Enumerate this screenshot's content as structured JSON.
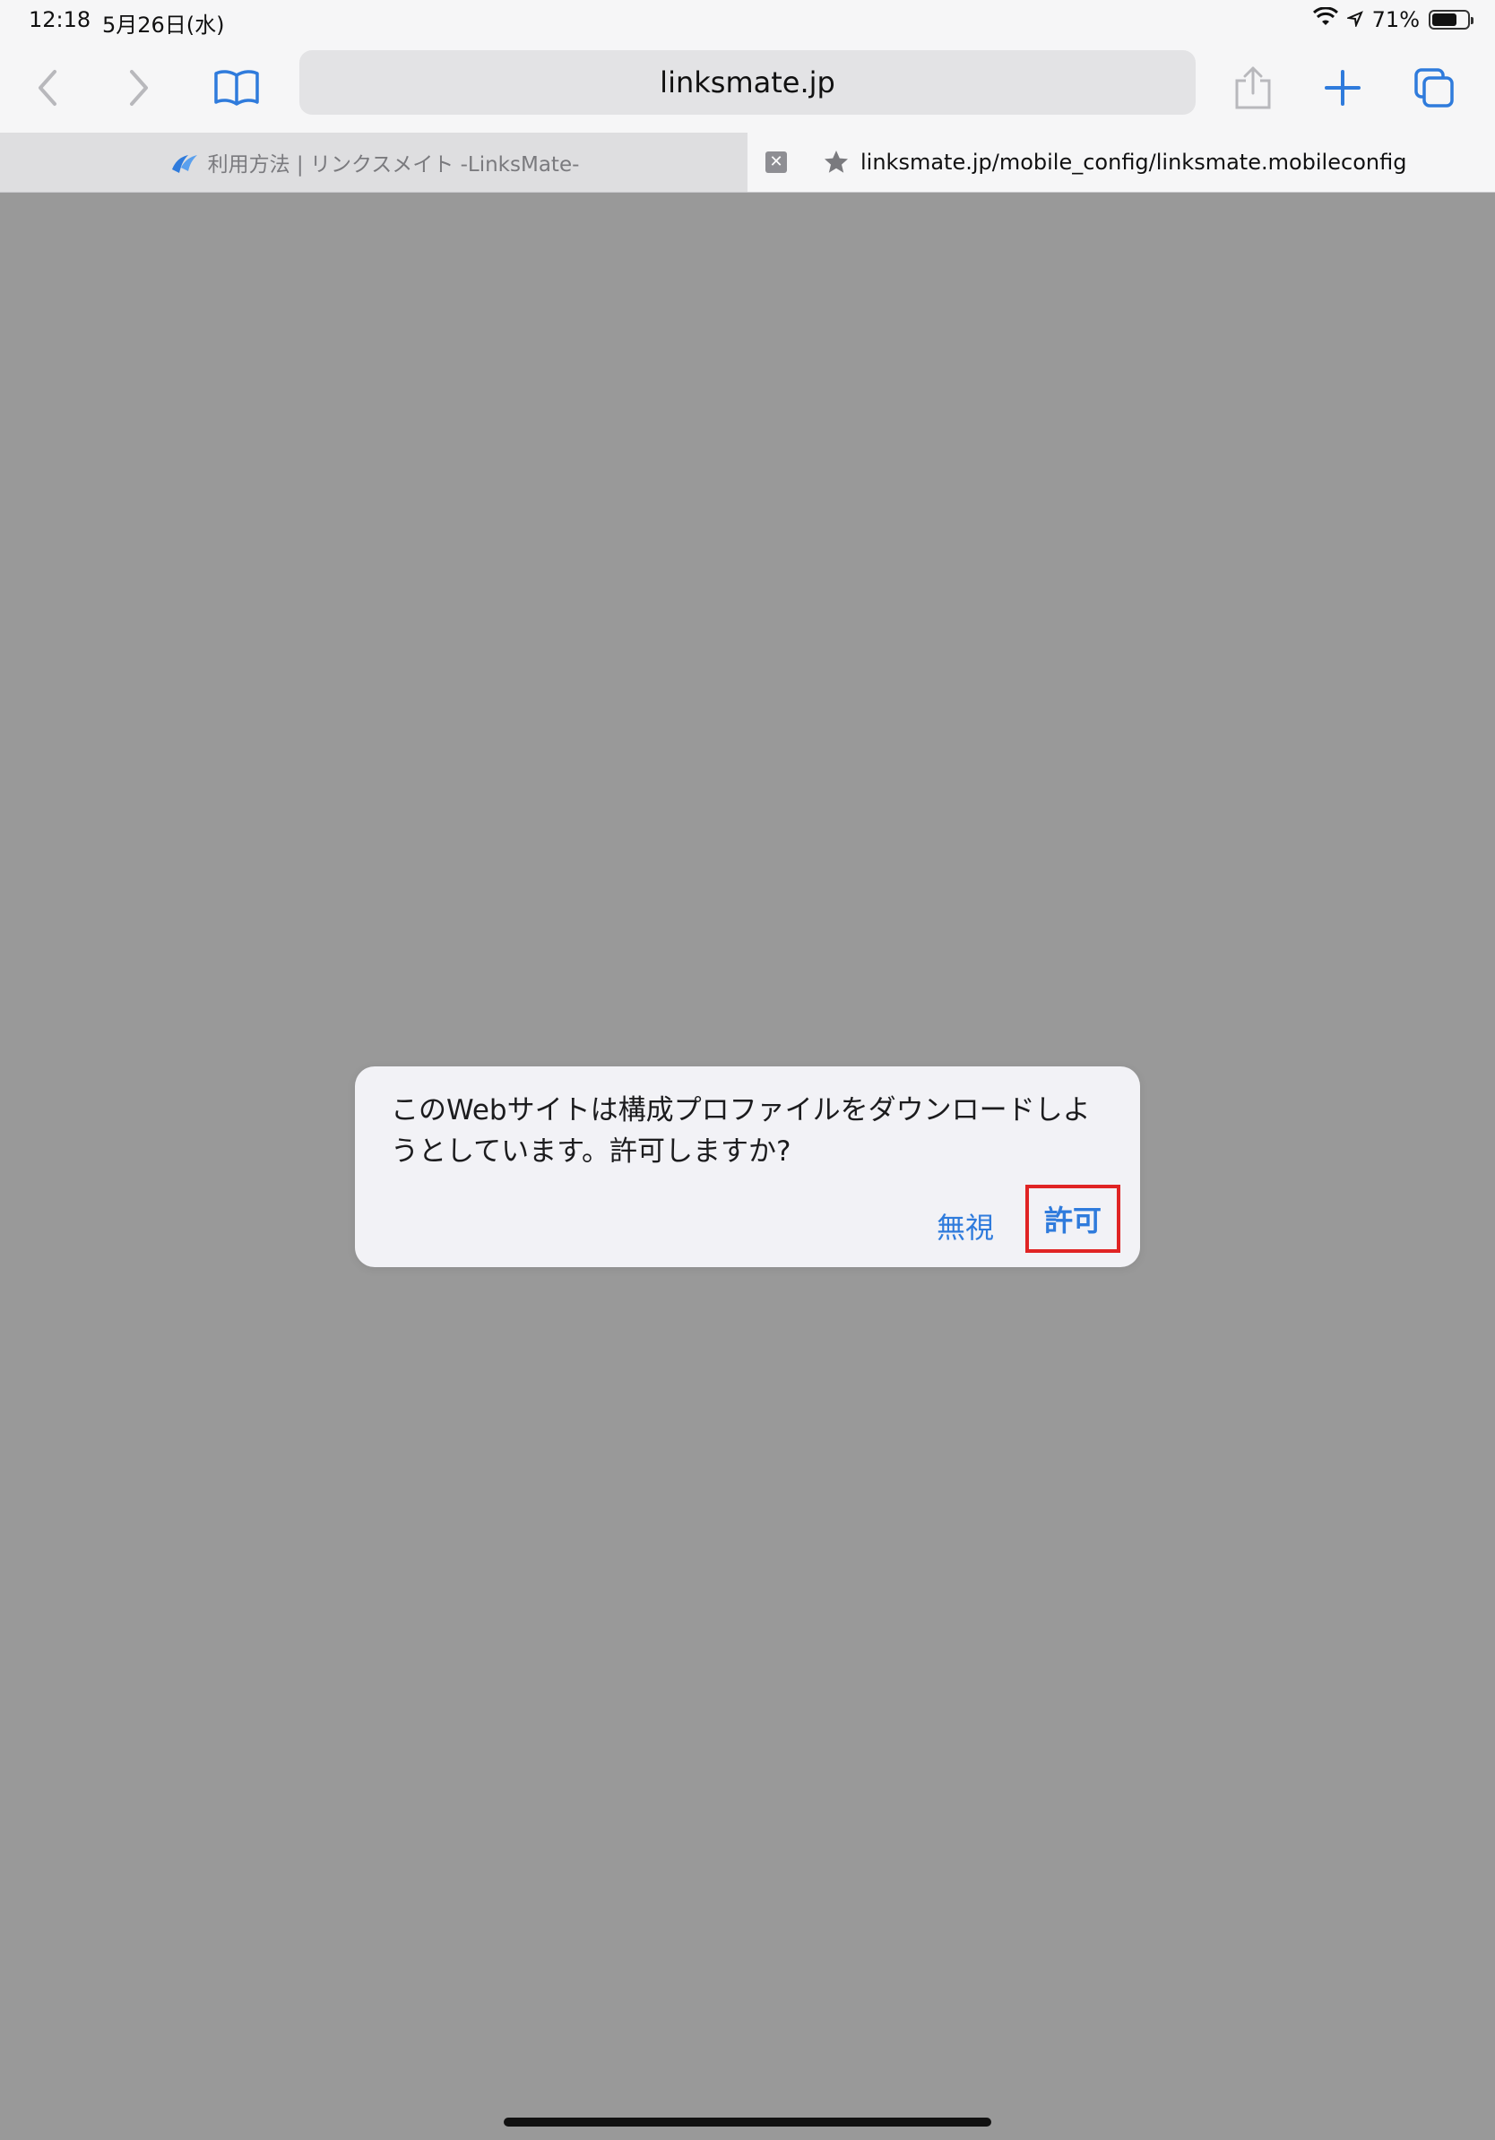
{
  "status_bar": {
    "time": "12:18",
    "date": "5月26日(水)",
    "battery_percent": "71%",
    "battery_level": 0.71
  },
  "toolbar": {
    "url": "linksmate.jp",
    "icons": [
      "back-icon",
      "forward-icon",
      "bookmarks-icon",
      "share-icon",
      "new-tab-icon",
      "tabs-icon"
    ]
  },
  "tabs": [
    {
      "title": "利用方法 | リンクスメイト -LinksMate-",
      "active": false,
      "icon": "linksmate-logo-icon"
    },
    {
      "title": "linksmate.jp/mobile_config/linksmate.mobileconfig",
      "active": true,
      "icon": "star-icon"
    }
  ],
  "alert": {
    "message": "このWebサイトは構成プロファイルをダウンロードしようとしています。許可しますか?",
    "ignore_label": "無視",
    "allow_label": "許可"
  },
  "colors": {
    "accent": "#2f7bdc",
    "highlight": "#e02424",
    "backdrop": "#999999"
  }
}
